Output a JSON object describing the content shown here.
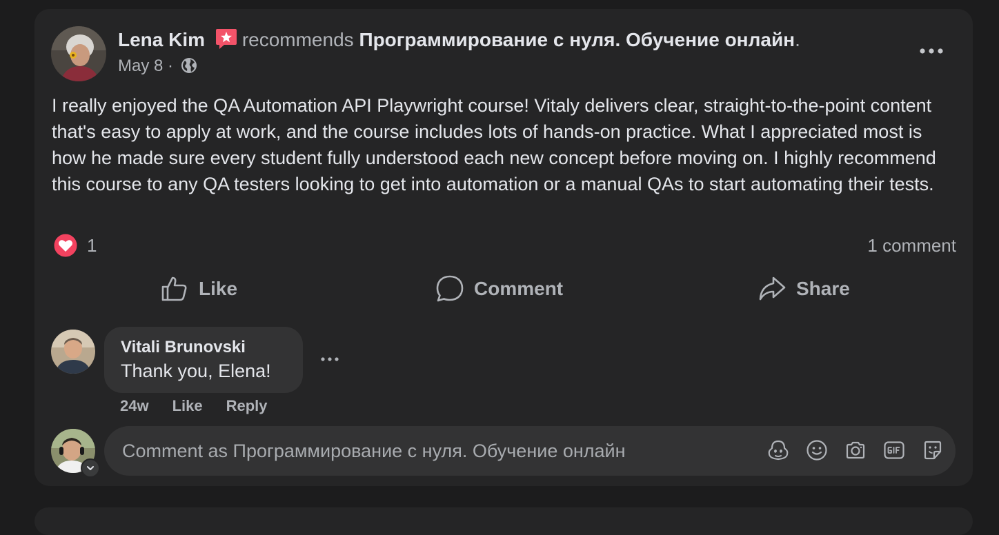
{
  "post": {
    "author": "Lena Kim",
    "recommends_label": "recommends",
    "page_name": "Программирование с нуля. Обучение онлайн",
    "period": ".",
    "date": "May 8",
    "separator": "·",
    "privacy_icon": "globe-icon",
    "more_icon": "more-horizontal-icon",
    "text": "I really enjoyed the QA Automation API Playwright course! Vitaly delivers clear, straight-to-the-point content that's easy to apply at work, and the course includes lots of hands-on practice. What I appreciated most is how he made sure every student fully understood each new concept before moving on. I highly recommend this course to any QA testers looking to get into automation or a manual QAs to start automating their tests."
  },
  "reactions": {
    "icon": "love-reaction-icon",
    "count": "1",
    "comments": "1 comment"
  },
  "actions": {
    "like": "Like",
    "comment": "Comment",
    "share": "Share"
  },
  "comment": {
    "author": "Vitali Brunovski",
    "text": "Thank you, Elena!",
    "age": "24w",
    "like": "Like",
    "reply": "Reply"
  },
  "composer": {
    "placeholder": "Comment as Программирование с нуля. Обучение онлайн",
    "tools": [
      "avatar-sticker-icon",
      "emoji-icon",
      "camera-icon",
      "gif-icon",
      "sticker-icon"
    ]
  },
  "colors": {
    "background": "#1c1c1d",
    "card": "#252526",
    "bubble": "#333334",
    "primary_text": "#e4e6eb",
    "secondary_text": "#b0b3b8",
    "love": "#f3425f",
    "badge": "#f35369"
  }
}
